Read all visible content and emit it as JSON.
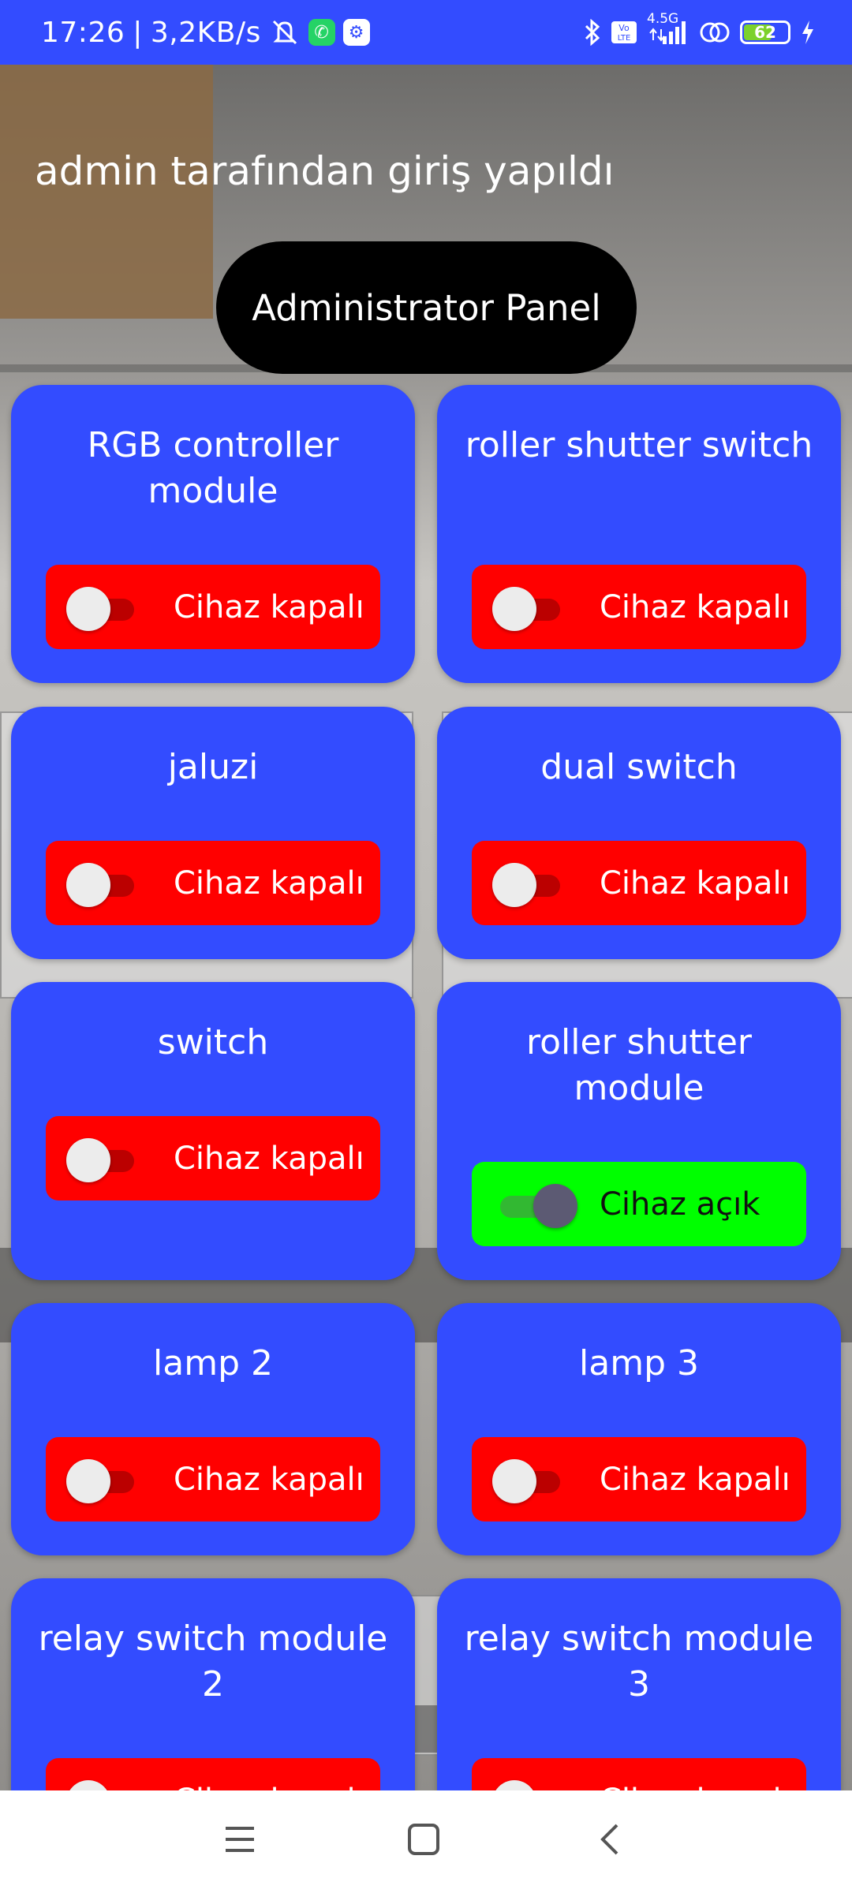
{
  "status_bar": {
    "time": "17:26",
    "separator": "|",
    "speed": "3,2KB/s",
    "network": "4.5G",
    "battery": "62",
    "icons": [
      "mute-icon",
      "whatsapp-icon",
      "settings-app-icon",
      "bluetooth-icon",
      "volte-icon",
      "signal-icon",
      "hotspot-icon",
      "battery-icon",
      "charging-icon"
    ]
  },
  "header": {
    "login_message": "admin tarafından giriş yapıldı",
    "admin_button": "Administrator Panel"
  },
  "devices": [
    {
      "title": "RGB controller module",
      "status": "Cihaz kapalı",
      "on": false
    },
    {
      "title": "roller shutter switch",
      "status": "Cihaz kapalı",
      "on": false
    },
    {
      "title": "jaluzi",
      "status": "Cihaz kapalı",
      "on": false
    },
    {
      "title": "dual switch",
      "status": "Cihaz kapalı",
      "on": false
    },
    {
      "title": "switch",
      "status": "Cihaz kapalı",
      "on": false
    },
    {
      "title": "roller shutter module",
      "status": "Cihaz açık",
      "on": true
    },
    {
      "title": "lamp 2",
      "status": "Cihaz kapalı",
      "on": false
    },
    {
      "title": "lamp 3",
      "status": "Cihaz kapalı",
      "on": false
    },
    {
      "title": "relay switch module 2",
      "status": "Cihaz kapalı",
      "on": false
    },
    {
      "title": "relay switch module 3",
      "status": "Cihaz kapalı",
      "on": false
    }
  ],
  "colors": {
    "accent": "#334cff",
    "off": "#ff0000",
    "on": "#00ff00",
    "admin_button": "#000000"
  },
  "nav": {
    "icons": [
      "menu-icon",
      "home-icon",
      "back-icon"
    ]
  }
}
